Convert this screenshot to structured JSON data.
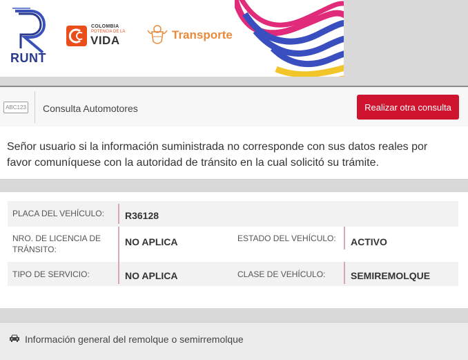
{
  "header": {
    "runt_logo_text": "RUNT",
    "colombia_logo": {
      "line1": "COLOMBIA",
      "line2": "POTENCIA DE LA",
      "line3": "VIDA"
    },
    "ministry_logo_text": "Transporte"
  },
  "toolbar": {
    "plate_icon_text": "ABC123",
    "title": "Consulta Automotores",
    "button_label": "Realizar otra consulta"
  },
  "notice": {
    "text": "Señor usuario si la información suministrada no corresponde con sus datos reales por favor comuníquese con la autoridad de tránsito en la cual solicitó su trámite."
  },
  "vehicle": {
    "placa_label": "PLACA DEL VEHÍCULO:",
    "placa_value": "R36128",
    "licencia_label": "NRO. DE LICENCIA DE TRÁNSITO:",
    "licencia_value": "NO APLICA",
    "estado_label": "ESTADO DEL VEHÍCULO:",
    "estado_value": "ACTIVO",
    "servicio_label": "TIPO DE SERVICIO:",
    "servicio_value": "NO APLICA",
    "clase_label": "CLASE DE VEHÍCULO:",
    "clase_value": "SEMIREMOLQUE"
  },
  "footer": {
    "icon": "car-icon",
    "section_title": "Información general del remolque o semirremolque"
  },
  "colors": {
    "accent_red": "#cf1430",
    "runt_blue": "#2a3a8c",
    "colombia_orange": "#e94e1b",
    "transporte_orange": "#e88a3a"
  }
}
